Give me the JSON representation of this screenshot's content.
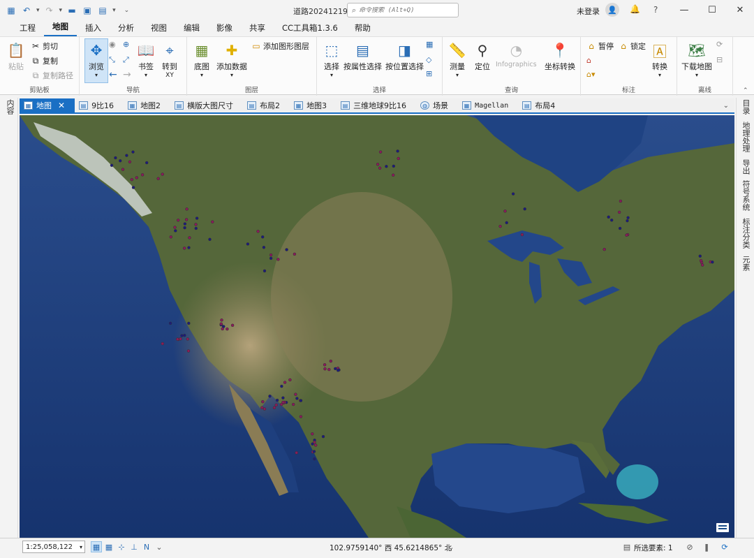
{
  "titlebar": {
    "doc_title": "道路20241219",
    "search_placeholder": "命令搜索 (Alt+Q)",
    "login": "未登录"
  },
  "ribbon_tabs": [
    "工程",
    "地图",
    "插入",
    "分析",
    "视图",
    "编辑",
    "影像",
    "共享",
    "CC工具箱1.3.6",
    "帮助"
  ],
  "active_ribbon_tab": "地图",
  "ribbon": {
    "clipboard": {
      "paste": "粘贴",
      "cut": "剪切",
      "copy": "复制",
      "copy_path": "复制路径",
      "label": "剪贴板"
    },
    "navigate": {
      "explore": "浏览",
      "bookmarks": "书签",
      "goto": "转到",
      "goto_sub": "XY",
      "label": "导航"
    },
    "layer": {
      "basemap": "底图",
      "add_data": "添加数据",
      "add_graphics": "添加图形图层",
      "label": "图层"
    },
    "selection": {
      "select": "选择",
      "by_attr": "按属性选择",
      "by_loc": "按位置选择",
      "label": "选择"
    },
    "inquiry": {
      "measure": "测量",
      "locate": "定位",
      "infographics": "Infographics",
      "convert_coords": "坐标转换",
      "label": "查询"
    },
    "labeling": {
      "pause": "暂停",
      "lock": "锁定",
      "convert": "转换",
      "label": "标注"
    },
    "offline": {
      "download_map": "下载地图",
      "label": "离线"
    }
  },
  "left_pane": "内容",
  "doc_tabs": [
    {
      "label": "地图",
      "active": true
    },
    {
      "label": "9比16"
    },
    {
      "label": "地图2"
    },
    {
      "label": "横版大图尺寸"
    },
    {
      "label": "布局2"
    },
    {
      "label": "地图3"
    },
    {
      "label": "三维地球9比16"
    },
    {
      "label": "场景"
    },
    {
      "label": "Magellan"
    },
    {
      "label": "布局4"
    }
  ],
  "right_panes": [
    "目录",
    "地理处理",
    "导出",
    "符号系统",
    "标注分类",
    "元素"
  ],
  "statusbar": {
    "scale": "1:25,058,122",
    "coords": "102.9759140° 西  45.6214865° 北",
    "selected_features": "所选要素: 1"
  },
  "colors": {
    "accent": "#1a6fc4",
    "ocean": "#1f3f7a",
    "land": "#5c6b3c",
    "desert": "#9b8a64",
    "point": "#8a1b5a"
  }
}
